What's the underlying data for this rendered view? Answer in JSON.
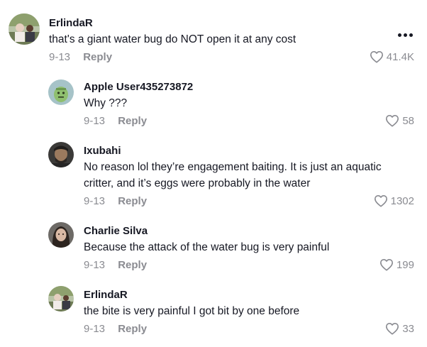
{
  "comments": [
    {
      "author": "ErlindaR",
      "text": [
        "that's a giant water bug do NOT open it at any cost"
      ],
      "date": "9-13",
      "reply_label": "Reply",
      "likes": "41.4K"
    },
    {
      "author": "Apple User435273872",
      "text": [
        "Why ???"
      ],
      "date": "9-13",
      "reply_label": "Reply",
      "likes": "58"
    },
    {
      "author": "Ixubahi",
      "text": [
        "No reason lol they’re engagement baiting. It is just an aquatic",
        "critter, and it’s eggs were probably in the water"
      ],
      "date": "9-13",
      "reply_label": "Reply",
      "likes": "1302"
    },
    {
      "author": "Charlie Silva",
      "text": [
        "Because the attack of the water bug is very painful"
      ],
      "date": "9-13",
      "reply_label": "Reply",
      "likes": "199"
    },
    {
      "author": "ErlindaR",
      "text": [
        "the bite is very painful I got bit by one before"
      ],
      "date": "9-13",
      "reply_label": "Reply",
      "likes": "33"
    }
  ],
  "icons": {
    "like": "heart-outline-icon",
    "more": "more-options-icon"
  },
  "colors": {
    "text": "#161823",
    "muted": "#8a8b91"
  }
}
